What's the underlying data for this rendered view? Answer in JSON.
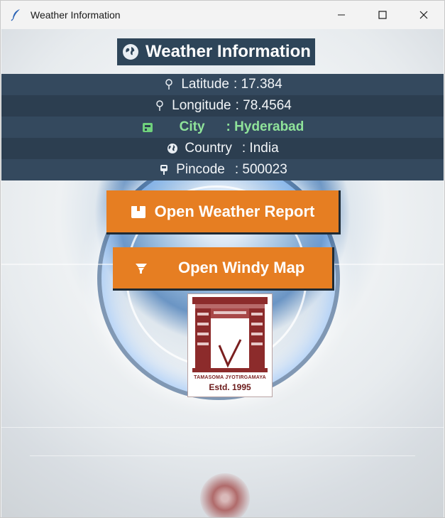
{
  "window": {
    "title": "Weather Information",
    "controls": [
      "minimize",
      "maximize",
      "close"
    ]
  },
  "header": {
    "icon": "globe-icon",
    "title": "Weather Information"
  },
  "info_rows": [
    {
      "icon": "pin-icon",
      "label": "Latitude",
      "value": ": 17.384"
    },
    {
      "icon": "pin-icon",
      "label": "Longitude",
      "value": ": 78.4564"
    },
    {
      "icon": "city-icon",
      "label": "City",
      "value": ": Hyderabad",
      "highlight_color": "#8fe39a"
    },
    {
      "icon": "globe-icon",
      "label": "Country",
      "value": ": India"
    },
    {
      "icon": "mailbox-icon",
      "label": "Pincode",
      "value": ": 500023"
    }
  ],
  "buttons": {
    "weather_report": {
      "label": "Open Weather Report",
      "icon": "box-icon"
    },
    "windy_map": {
      "label": "Open Windy Map",
      "icon": "wind-icon"
    }
  },
  "logo": {
    "motto": "TAMASOMA JYOTIRGAMAYA",
    "estd": "Estd. 1995"
  },
  "colors": {
    "header_bg": "#2e4559",
    "row_bg_light": "#34495e",
    "row_bg_dark": "#2c3e50",
    "button_bg": "#e67e22",
    "city_text": "#8fe39a"
  }
}
